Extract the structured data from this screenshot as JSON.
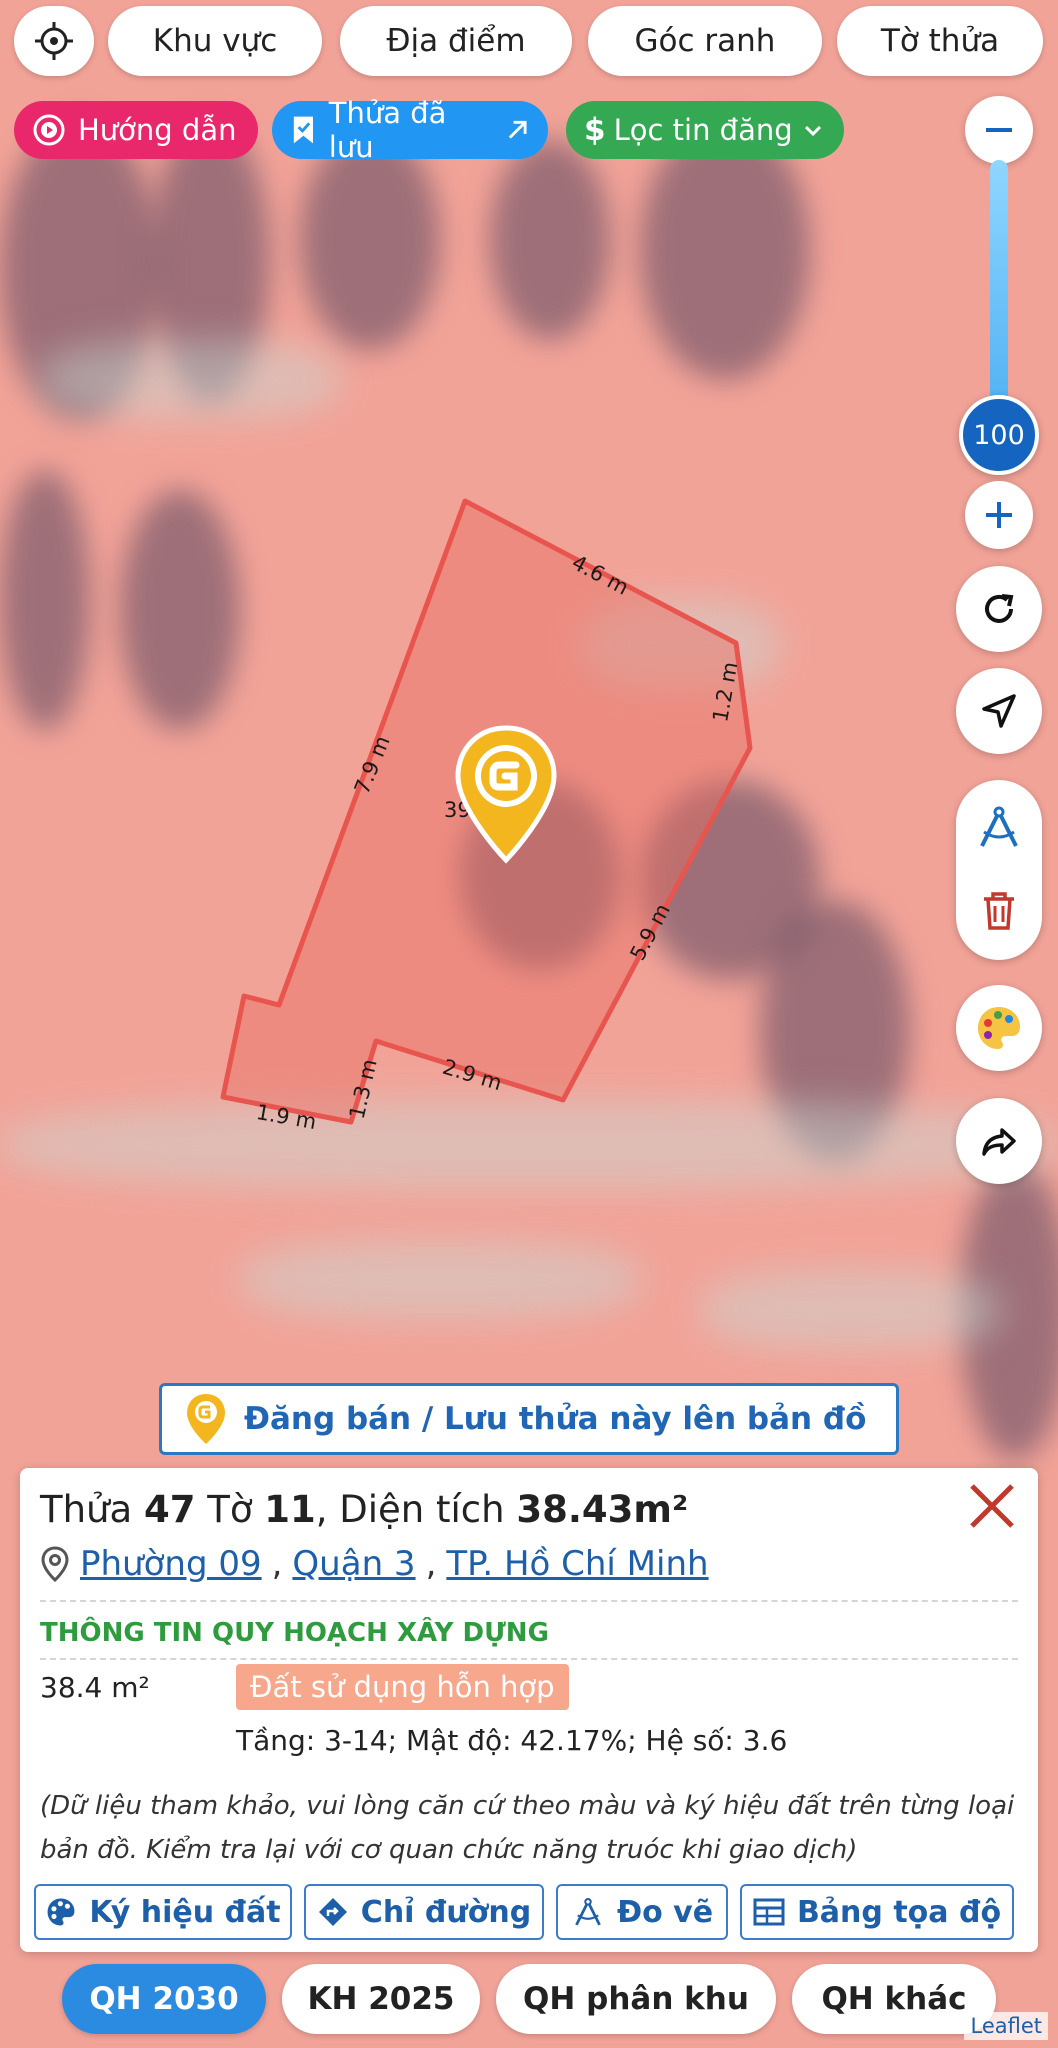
{
  "top_tabs": {
    "locate_icon": "gps-target-icon",
    "items": [
      "Khu vực",
      "Địa điểm",
      "Góc ranh",
      "Tờ thửa"
    ]
  },
  "pills": {
    "guide": {
      "label": "Hướng dẫn",
      "icon": "play-circle-icon",
      "color": "#e8286a"
    },
    "saved": {
      "label": "Thửa đã lưu",
      "icon": "bookmark-icon",
      "color": "#2196f3"
    },
    "filter": {
      "label": "Lọc tin đăng",
      "icon": "dollar-icon",
      "color": "#34a853"
    }
  },
  "zoom": {
    "level": "100"
  },
  "map": {
    "parcel_dimensions": [
      "4.6 m",
      "1.2 m",
      "5.9 m",
      "2.9 m",
      "1.3 m",
      "1.9 m",
      "7.9 m"
    ],
    "parcel_area_label": "39",
    "parcel_color": "#e8554e"
  },
  "post_banner": {
    "label": "Đăng bán / Lưu thửa này lên bản đồ"
  },
  "parcel_info": {
    "parcel_prefix": "Thửa",
    "parcel_no": "47",
    "sheet_prefix": "Tờ",
    "sheet_no": "11",
    "area_prefix": ", Diện tích",
    "area": "38.43m²",
    "ward": "Phường 09",
    "district": "Quận 3",
    "city": "TP. Hồ Chí Minh",
    "section_title": "THÔNG TIN QUY HOẠCH XÂY DỰNG",
    "zone_area": "38.4 m²",
    "zone_type": "Đất sử dụng hỗn hợp",
    "zone_detail": "Tầng: 3-14; Mật độ: 42.17%; Hệ số: 3.6",
    "note": "(Dữ liệu tham khảo, vui lòng căn cứ theo màu và ký hiệu đất trên từng loại bản đồ. Kiểm tra lại với cơ quan chức năng truóc khi giao dịch)"
  },
  "actions": [
    {
      "label": "Ký hiệu đất",
      "icon": "palette-icon"
    },
    {
      "label": "Chỉ đường",
      "icon": "directions-icon"
    },
    {
      "label": "Đo vẽ",
      "icon": "compass-draw-icon"
    },
    {
      "label": "Bảng tọa độ",
      "icon": "table-icon"
    }
  ],
  "bottom_tabs": [
    "QH 2030",
    "KH 2025",
    "QH phân khu",
    "QH khác"
  ],
  "attribution": "Leaflet"
}
